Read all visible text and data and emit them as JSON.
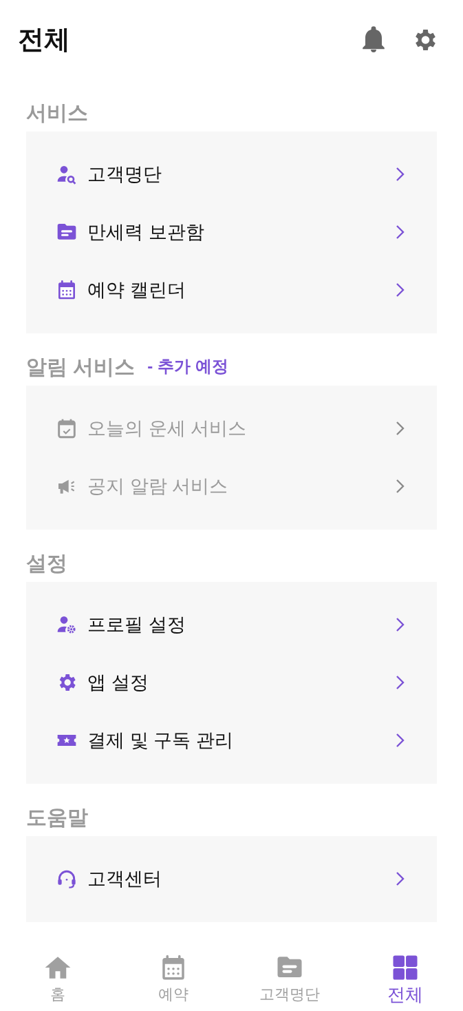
{
  "header": {
    "title": "전체"
  },
  "sections": [
    {
      "title": "서비스",
      "items": [
        {
          "label": "고객명단",
          "kind": "person-search",
          "disabled": false
        },
        {
          "label": "만세력 보관함",
          "kind": "folder",
          "disabled": false
        },
        {
          "label": "예약 캘린더",
          "kind": "calendar",
          "disabled": false
        }
      ]
    },
    {
      "title": "알림 서비스",
      "note": "- 추가 예정",
      "items": [
        {
          "label": "오늘의 운세 서비스",
          "kind": "calendar-check",
          "disabled": true
        },
        {
          "label": "공지 알람 서비스",
          "kind": "megaphone",
          "disabled": true
        }
      ]
    },
    {
      "title": "설정",
      "items": [
        {
          "label": "프로필 설정",
          "kind": "person-gear",
          "disabled": false
        },
        {
          "label": "앱 설정",
          "kind": "gear",
          "disabled": false
        },
        {
          "label": "결제 및 구독 관리",
          "kind": "ticket",
          "disabled": false
        }
      ]
    },
    {
      "title": "도움말",
      "items": [
        {
          "label": "고객센터",
          "kind": "headset",
          "disabled": false
        }
      ]
    }
  ],
  "bottom_nav": [
    {
      "label": "홈",
      "kind": "home",
      "selected": false
    },
    {
      "label": "예약",
      "kind": "calendar",
      "selected": false
    },
    {
      "label": "고객명단",
      "kind": "folder",
      "selected": false
    },
    {
      "label": "전체",
      "kind": "grid",
      "selected": true
    }
  ]
}
